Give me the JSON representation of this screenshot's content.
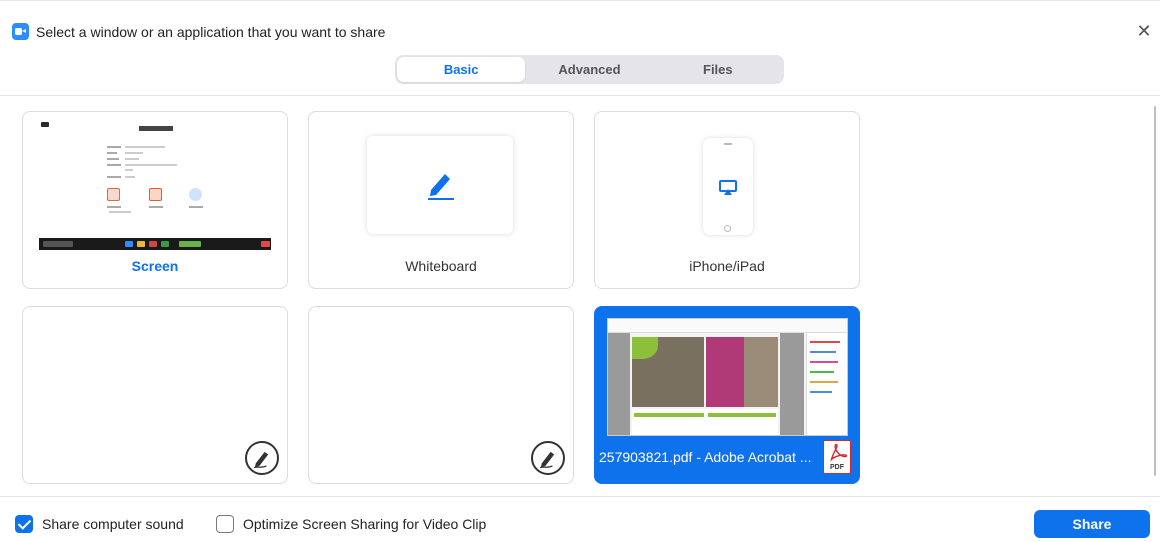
{
  "window": {
    "title": "Select a window or an application that you want to share",
    "close_symbol": "✕"
  },
  "tabs": [
    {
      "label": "Basic",
      "active": true
    },
    {
      "label": "Advanced",
      "active": false
    },
    {
      "label": "Files",
      "active": false
    }
  ],
  "tiles": [
    {
      "label": "Screen",
      "selected": false
    },
    {
      "label": "Whiteboard",
      "selected": false
    },
    {
      "label": "iPhone/iPad",
      "selected": false
    },
    {
      "label": "",
      "icon": "pen-edit-icon"
    },
    {
      "label": "",
      "icon": "pen-edit-icon"
    },
    {
      "label": "257903821.pdf - Adobe Acrobat ...",
      "selected": true,
      "icon": "pdf-icon",
      "icon_text": "PDF"
    }
  ],
  "options": {
    "share_sound": {
      "label": "Share computer sound",
      "checked": true
    },
    "optimize_video": {
      "label": "Optimize Screen Sharing for Video Clip",
      "checked": false
    }
  },
  "actions": {
    "share_label": "Share"
  },
  "colors": {
    "accent": "#0e72ed",
    "selected_tile": "#0e72ed"
  }
}
